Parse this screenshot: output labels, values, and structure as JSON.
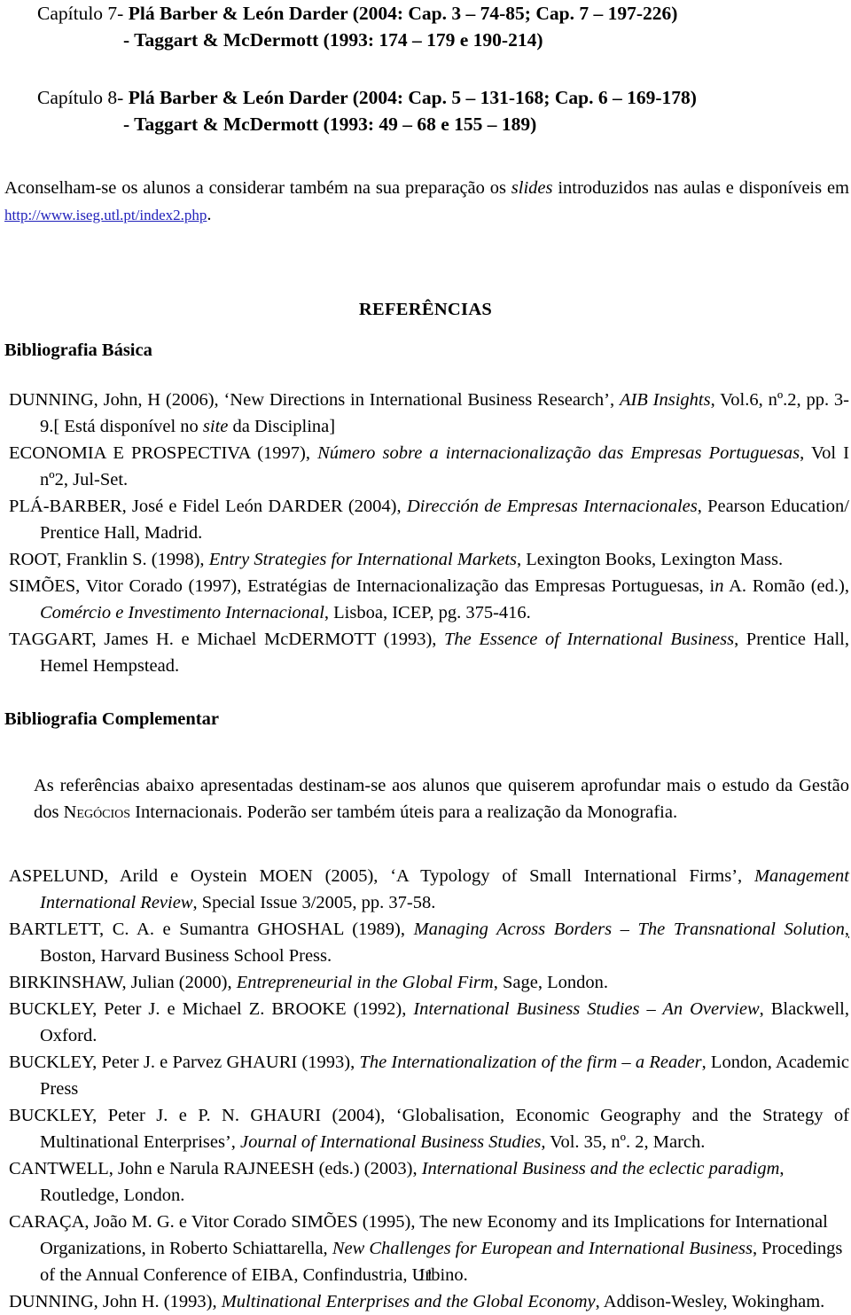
{
  "document": {
    "page_number": "11",
    "link_color": "#2222bb"
  },
  "chapters": [
    {
      "lead": "Capítulo 7- ",
      "line1": "Plá Barber & León Darder (2004: Cap. 3 – 74-85; Cap. 7 – 197-226)",
      "line2": "- Taggart & McDermott (1993: 174 – 179 e 190-214)"
    },
    {
      "lead": "Capítulo 8- ",
      "line1": "Plá Barber & León Darder (2004: Cap. 5 – 131-168; Cap. 6 – 169-178)",
      "line2": "- Taggart & McDermott (1993: 49 – 68 e 155 – 189)"
    }
  ],
  "advisory": {
    "part1": "Aconselham-se os alunos a considerar também na sua preparação os ",
    "italic": "slides",
    "part2": " introduzidos nas aulas e disponíveis em ",
    "url": "http://www.iseg.utl.pt/index2.php",
    "part3": "."
  },
  "headings": {
    "references": "REFERÊNCIAS",
    "basic_bibliography": "Bibliografia Básica",
    "complementary_bibliography": "Bibliografia Complementar"
  },
  "complementary_intro": {
    "part1": "As referências abaixo apresentadas destinam-se aos alunos que quiserem aprofundar mais o estudo da Gestão dos ",
    "smallcaps": "Negócios",
    "part2": " Internacionais. Poderão ser também úteis para a realização da Monografia."
  },
  "basic_bibliography": [
    {
      "id": "dunning-2006",
      "segments": [
        {
          "style": "normal",
          "text": "DUNNING, John, H (2006), ‘New Directions in International Business Research’, "
        },
        {
          "style": "italic",
          "text": "AIB Insights"
        },
        {
          "style": "normal",
          "text": ", Vol.6, nº.2, pp. 3-9.[ Está disponível no "
        },
        {
          "style": "italic",
          "text": "site"
        },
        {
          "style": "normal",
          "text": " da Disciplina]"
        }
      ]
    },
    {
      "id": "economia-prospectiva-1997",
      "segments": [
        {
          "style": "normal",
          "text": "ECONOMIA E PROSPECTIVA (1997), "
        },
        {
          "style": "italic",
          "text": "Número sobre a internacionalização das Empresas Portuguesas"
        },
        {
          "style": "normal",
          "text": ", Vol I nº2, Jul-Set."
        }
      ]
    },
    {
      "id": "pla-barber-2004",
      "segments": [
        {
          "style": "normal",
          "text": "PLÁ-BARBER, José e Fidel León DARDER (2004), "
        },
        {
          "style": "italic",
          "text": "Dirección de Empresas Internacionales"
        },
        {
          "style": "normal",
          "text": ", Pearson Education/ Prentice Hall, Madrid."
        }
      ]
    },
    {
      "id": "root-1998",
      "segments": [
        {
          "style": "normal",
          "text": "ROOT, Franklin S. (1998), "
        },
        {
          "style": "italic",
          "text": "Entry Strategies for International Markets"
        },
        {
          "style": "normal",
          "text": ", Lexington Books, Lexington Mass."
        }
      ]
    },
    {
      "id": "simoes-1997",
      "segments": [
        {
          "style": "normal",
          "text": "SIMÕES, Vitor Corado (1997), Estratégias de Internacionalização das Empresas Portuguesas, i"
        },
        {
          "style": "italic",
          "text": "n"
        },
        {
          "style": "normal",
          "text": " A. Romão (ed.), "
        },
        {
          "style": "italic",
          "text": "Comércio e Investimento Internacional"
        },
        {
          "style": "normal",
          "text": ", Lisboa, ICEP, pg. 375-416."
        }
      ]
    },
    {
      "id": "taggart-1993",
      "segments": [
        {
          "style": "normal",
          "text": "TAGGART, James H. e Michael McDERMOTT (1993), "
        },
        {
          "style": "italic",
          "text": "The Essence of International Business"
        },
        {
          "style": "normal",
          "text": ", Prentice Hall, Hemel Hempstead."
        }
      ]
    }
  ],
  "complementary_bibliography": [
    {
      "id": "aspelund-2005",
      "segments": [
        {
          "style": "normal",
          "text": "ASPELUND, Arild e Oystein MOEN (2005), ‘A Typology of Small International Firms’, "
        },
        {
          "style": "italic",
          "text": "Management International Review"
        },
        {
          "style": "normal",
          "text": ", Special Issue 3/2005, pp. 37-58."
        }
      ]
    },
    {
      "id": "bartlett-1989",
      "segments": [
        {
          "style": "normal",
          "text": "BARTLETT, C. A. e Sumantra GHOSHAL (1989), "
        },
        {
          "style": "italic",
          "text": "Managing Across Borders – The Transnational Solution"
        },
        {
          "style": "underline",
          "text": ","
        },
        {
          "style": "normal",
          "text": " Boston, Harvard Business School Press."
        }
      ]
    },
    {
      "id": "birkinshaw-2000",
      "segments": [
        {
          "style": "normal",
          "text": "BIRKINSHAW, Julian (2000), "
        },
        {
          "style": "italic",
          "text": "Entrepreneurial in the Global Firm"
        },
        {
          "style": "normal",
          "text": ", Sage, London."
        }
      ]
    },
    {
      "id": "buckley-brooke-1992",
      "segments": [
        {
          "style": "normal",
          "text": "BUCKLEY, Peter J. e Michael Z. BROOKE (1992), "
        },
        {
          "style": "italic",
          "text": "International Business Studies – An Overview"
        },
        {
          "style": "normal",
          "text": ", Blackwell, Oxford."
        }
      ]
    },
    {
      "id": "buckley-ghauri-1993",
      "segments": [
        {
          "style": "normal",
          "text": "BUCKLEY, Peter J. e Parvez GHAURI (1993), "
        },
        {
          "style": "italic",
          "text": "The Internationalization of the firm – a Reader"
        },
        {
          "style": "normal",
          "text": ", London, Academic Press"
        }
      ]
    },
    {
      "id": "buckley-ghauri-2004",
      "segments": [
        {
          "style": "normal",
          "text": "BUCKLEY, Peter J. e P. N. GHAURI (2004), ‘Globalisation, Economic Geography and the Strategy of Multinational Enterprises’, "
        },
        {
          "style": "italic",
          "text": "Journal of International Business Studies"
        },
        {
          "style": "normal",
          "text": ", Vol. 35, nº. 2, March."
        }
      ]
    },
    {
      "id": "cantwell-2003",
      "segments": [
        {
          "style": "normal",
          "text": "CANTWELL, John e Narula RAJNEESH (eds.) (2003), "
        },
        {
          "style": "italic",
          "text": "International Business and the eclectic paradigm"
        },
        {
          "style": "normal",
          "text": ", Routledge, London."
        }
      ]
    },
    {
      "id": "caraca-1995",
      "segments": [
        {
          "style": "normal",
          "text": "CARAÇA, João M. G. e Vitor Corado SIMÕES (1995), The new Economy and its Implications for International Organizations, in Roberto Schiattarella, "
        },
        {
          "style": "italic",
          "text": "New Challenges for European and International Business"
        },
        {
          "style": "normal",
          "text": ", Procedings of the Annual Conference of EIBA, Confindustria, Urbino."
        }
      ]
    },
    {
      "id": "dunning-1993",
      "segments": [
        {
          "style": "normal",
          "text": "DUNNING, John H. (1993), "
        },
        {
          "style": "italic",
          "text": "Multinational Enterprises and the Global Economy"
        },
        {
          "style": "normal",
          "text": ", Addison-Wesley, Wokingham."
        }
      ]
    }
  ]
}
